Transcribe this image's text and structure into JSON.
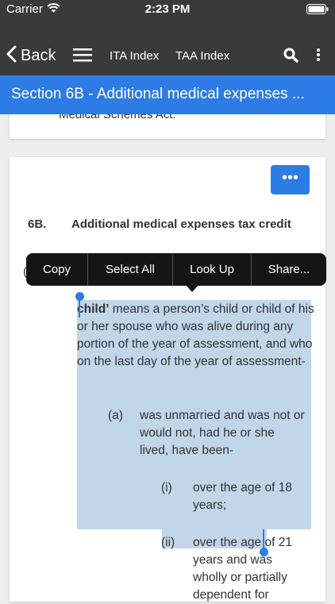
{
  "status_bar": {
    "carrier": "Carrier",
    "time": "2:23 PM"
  },
  "nav": {
    "back_label": "Back",
    "ita_index": "ITA Index",
    "taa_index": "TAA Index",
    "icons": [
      "chevron-left-icon",
      "hamburger-menu-icon",
      "search-icon",
      "more-vertical-icon"
    ]
  },
  "section_header": {
    "title": "Section 6B - Additional medical expenses ..."
  },
  "top_card": {
    "partial_text": "Medical Schemes Act."
  },
  "content": {
    "more_button_label": "•••",
    "section_number": "6B.",
    "section_heading": "Additional medical expenses tax credit",
    "partial_paren": "(",
    "child_term": "child’",
    "child_definition": " means a person’s child or child of his or her spouse who was alive during any portion of the year of assessment, and who on the last day of the year of assessment-",
    "a_label": "(a)",
    "a_text": "was unmarried and was not or would not, had he or she lived, have been-",
    "i_label": "(i)",
    "i_text": "over the age of 18 years;",
    "ii_label": "(ii)",
    "ii_text": "over the age of 21 years and was wholly or partially dependent for"
  },
  "edit_menu": {
    "copy": "Copy",
    "select_all": "Select All",
    "look_up": "Look Up",
    "share": "Share..."
  },
  "colors": {
    "nav_bg": "#3a3a3a",
    "accent": "#2d7be5",
    "selection": "#c2d6ea",
    "menu_bg": "#151515"
  }
}
